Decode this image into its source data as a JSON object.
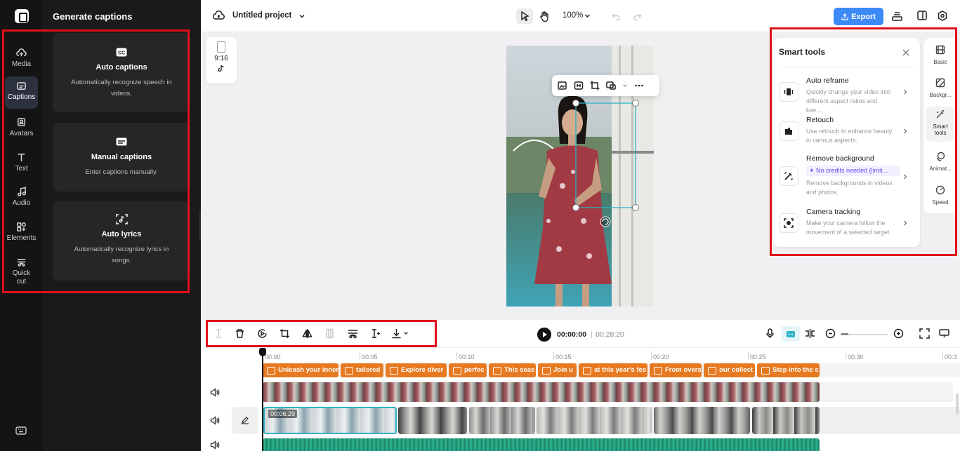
{
  "rail": {
    "items": [
      {
        "label": "Media",
        "icon": "cloud-upload-icon"
      },
      {
        "label": "Captions",
        "icon": "captions-icon",
        "active": true
      },
      {
        "label": "Avatars",
        "icon": "avatar-icon"
      },
      {
        "label": "Text",
        "icon": "text-icon"
      },
      {
        "label": "Audio",
        "icon": "music-icon"
      },
      {
        "label": "Elements",
        "icon": "elements-icon"
      },
      {
        "label": "Quick cut",
        "icon": "scissors-icon"
      }
    ]
  },
  "captions_panel": {
    "title": "Generate captions",
    "cards": [
      {
        "title": "Auto captions",
        "desc": "Automatically recognize speech in videos.",
        "icon": "cc-icon"
      },
      {
        "title": "Manual captions",
        "desc": "Enter captions manually.",
        "icon": "keyboard-caption-icon"
      },
      {
        "title": "Auto lyrics",
        "desc": "Automatically recognize lyrics in songs.",
        "icon": "music-scan-icon"
      }
    ]
  },
  "topbar": {
    "project_name": "Untitled project",
    "zoom": "100%",
    "export_label": "Export"
  },
  "canvas": {
    "ratio": "9:16"
  },
  "smart_tools": {
    "title": "Smart tools",
    "tools": [
      {
        "name": "Auto reframe",
        "desc": "Quickly change your video into different aspect ratios and kee...",
        "icon": "reframe-icon"
      },
      {
        "name": "Retouch",
        "desc": "Use retouch to enhance beauty in various aspects.",
        "icon": "retouch-icon"
      },
      {
        "name": "Remove background",
        "badge": "✦ No credits needed (limit...",
        "desc": "Remove backgrounds in videos and photos.",
        "icon": "remove-bg-icon"
      },
      {
        "name": "Camera tracking",
        "desc": "Make your camera follow the movement of a selected target.",
        "icon": "camera-tracking-icon"
      }
    ]
  },
  "right_tabs": [
    {
      "label": "Basic",
      "icon": "film-icon"
    },
    {
      "label": "Backgr...",
      "icon": "background-icon"
    },
    {
      "label": "Smart tools",
      "icon": "magic-wand-icon",
      "active": true
    },
    {
      "label": "Animat...",
      "icon": "animation-icon"
    },
    {
      "label": "Speed",
      "icon": "speed-icon"
    }
  ],
  "timeline": {
    "current_time": "00:00:00",
    "separator": "|",
    "total_time": "00:28:20",
    "ruler": [
      "00:00",
      "00:05",
      "00:10",
      "00:15",
      "00:20",
      "00:25",
      "00:30",
      "00:3"
    ],
    "captions": [
      "Unleash your inner",
      "tailored",
      "Explore diver",
      "perfec",
      "This seas",
      "Join u",
      "at this year's fes",
      "From overs",
      "our collect",
      "Step into the s"
    ],
    "clip_time": "00:06:29"
  }
}
